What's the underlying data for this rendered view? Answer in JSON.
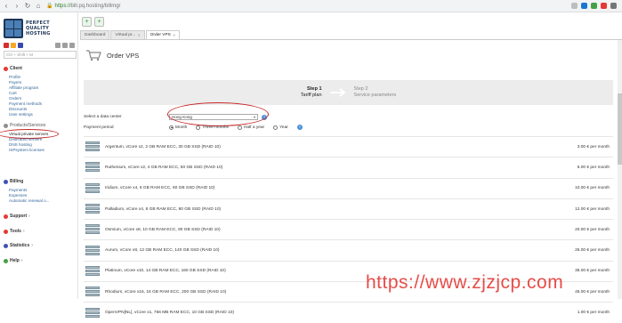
{
  "browser": {
    "url_scheme": "https://",
    "url_rest": "bill.pq.hosting/billmgr"
  },
  "logo": {
    "line1": "PERFECT",
    "line2": "QUALITY",
    "line3": "HOSTING"
  },
  "sidebar": {
    "search_placeholder": "Ctrl + Shift + M",
    "sections": [
      {
        "title": "Client",
        "color": "#e53935"
      },
      {
        "title": "Products/Services",
        "color": "#8e8e8e"
      },
      {
        "title": "Billing",
        "color": "#3f51b5"
      },
      {
        "title": "Support",
        "color": "#e53935"
      },
      {
        "title": "Tools",
        "color": "#e53935"
      },
      {
        "title": "Statistics",
        "color": "#3f51b5"
      },
      {
        "title": "Help",
        "color": "#43a047"
      }
    ],
    "client_items": [
      "Profile",
      "Payers",
      "Affiliate program",
      "Cart",
      "Orders",
      "Payment methods",
      "Discounts",
      "User settings"
    ],
    "products_items": [
      "Virtual private servers",
      "Dedicated servers",
      "DNS hosting",
      "ISPsystem licenses"
    ],
    "billing_items": [
      "Payments",
      "Expenses",
      "Automatic renewal o..."
    ]
  },
  "tabs": [
    {
      "label": "Dashboard"
    },
    {
      "label": "Virtual pr..."
    },
    {
      "label": "Order VPS"
    }
  ],
  "page": {
    "title": "Order VPS"
  },
  "steps": {
    "step1": {
      "label": "Step 1",
      "sub": "Tariff plan"
    },
    "step2": {
      "label": "Step 2",
      "sub": "Service parameters"
    }
  },
  "form": {
    "datacenter_label": "Select a data center",
    "datacenter_value": "Hong Kong",
    "period_label": "Payment period",
    "period_options": [
      "Month",
      "Three months",
      "Half a year",
      "Year"
    ],
    "period_selected": "Month"
  },
  "plans": [
    {
      "desc": "Argentum, vCore x2, 2 GB RAM ECC, 30 GB SSD (RAID 10)",
      "price": "3.00 € per month"
    },
    {
      "desc": "Ruthenium, vCore x2, 4 GB RAM ECC, 50 GB SSD (RAID 10)",
      "price": "6.00 € per month"
    },
    {
      "desc": "Iridium, vCore x4, 6 GB RAM ECC, 60 GB SSD (RAID 10)",
      "price": "10.00 € per month"
    },
    {
      "desc": "Palladium, vCore x4, 8 GB RAM ECC, 80 GB SSD (RAID 10)",
      "price": "12.00 € per month"
    },
    {
      "desc": "Osmium, vCore x8, 10 GB RAM ECC, 90 GB SSD (RAID 10)",
      "price": "20.00 € per month"
    },
    {
      "desc": "Aurum, vCore x8, 12 GB RAM ECC, 140 GB SSD (RAID 10)",
      "price": "25.00 € per month"
    },
    {
      "desc": "Platinum, vCore x10, 14 GB RAM ECC, 160 GB SSD (RAID 10)",
      "price": "35.00 € per month"
    },
    {
      "desc": "Rhodium, vCore x16, 16 GB RAM ECC, 200 GB SSD (RAID 10)",
      "price": "45.00 € per month"
    },
    {
      "desc": "OpenVPN[NL], vCore x1, 756 MB RAM ECC, 10 GB SSD (RAID 10)",
      "price": "1.00 € per month"
    }
  ],
  "watermark": "https://www.zjzjcp.com"
}
